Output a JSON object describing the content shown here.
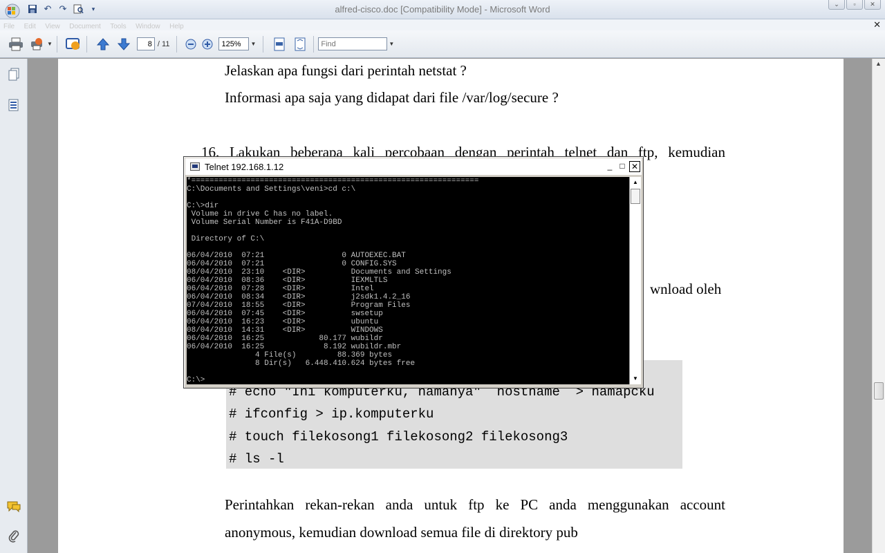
{
  "window": {
    "title": "alfred-cisco.doc [Compatibility Mode] - Microsoft Word",
    "controls": [
      "⌄",
      "▫",
      "✕"
    ]
  },
  "menu": {
    "items": [
      "File",
      "Edit",
      "View",
      "Document",
      "Tools",
      "Window",
      "Help"
    ],
    "close": "✕"
  },
  "toolbar": {
    "page_current": "8",
    "page_total": "/ 11",
    "zoom": "125%",
    "find_placeholder": "Find"
  },
  "document": {
    "lines": [
      "Jelaskan apa fungsi dari perintah netstat ?",
      "Informasi apa saja yang didapat dari file /var/log/secure ?",
      "16. Lakukan beberapa kali percobaan dengan perintah telnet dan ftp, kemudian",
      "wnload oleh",
      "Perintahkan rekan-rekan anda untuk ftp ke PC anda menggunakan account",
      "anonymous, kemudian download semua file di direktory pub"
    ],
    "code": [
      "# echo \"Ini komputerku, namanya\" `hostname` > namapcku",
      "# ifconfig > ip.komputerku",
      "# touch filekosong1 filekosong2 filekosong3",
      "# ls -l"
    ]
  },
  "telnet": {
    "title": "Telnet 192.168.1.12",
    "controls": [
      "_",
      "□",
      "✕"
    ],
    "console": [
      "*===============================================================",
      "C:\\Documents and Settings\\veni>cd c:\\",
      "",
      "C:\\>dir",
      " Volume in drive C has no label.",
      " Volume Serial Number is F41A-D9BD",
      "",
      " Directory of C:\\",
      "",
      "06/04/2010  07:21                 0 AUTOEXEC.BAT",
      "06/04/2010  07:21                 0 CONFIG.SYS",
      "08/04/2010  23:10    <DIR>          Documents and Settings",
      "06/04/2010  08:36    <DIR>          IEXMLTLS",
      "06/04/2010  07:28    <DIR>          Intel",
      "06/04/2010  08:34    <DIR>          j2sdk1.4.2_16",
      "07/04/2010  18:55    <DIR>          Program Files",
      "06/04/2010  07:45    <DIR>          swsetup",
      "06/04/2010  16:23    <DIR>          ubuntu",
      "08/04/2010  14:31    <DIR>          WINDOWS",
      "06/04/2010  16:25            80.177 wubildr",
      "06/04/2010  16:25             8.192 wubildr.mbr",
      "               4 File(s)         88.369 bytes",
      "               8 Dir(s)   6.448.410.624 bytes free",
      "",
      "C:\\>"
    ]
  },
  "icons": {
    "save": "💾",
    "undo": "↶",
    "redo": "↷",
    "print": "🖶",
    "up": "🡅",
    "down": "🡇",
    "zoom_out": "⊖",
    "zoom_in": "⊕",
    "pages": "🗐",
    "bookmarks": "📑",
    "comments": "💬",
    "attach": "📎"
  }
}
